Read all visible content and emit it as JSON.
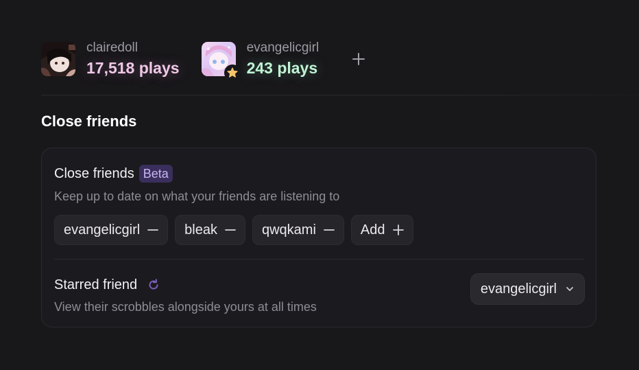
{
  "friends_row": {
    "users": [
      {
        "name": "clairedoll",
        "plays": "17,518 plays",
        "accent": "#f0c8e7"
      },
      {
        "name": "evangelicgirl",
        "plays": "243 plays",
        "accent": "#bff3d4"
      }
    ],
    "add_icon": "plus-icon"
  },
  "section": {
    "title": "Close friends"
  },
  "close_friends": {
    "title": "Close friends",
    "badge": "Beta",
    "description": "Keep up to date on what your friends are listening to",
    "chips": [
      {
        "label": "evangelicgirl",
        "icon": "minus-icon"
      },
      {
        "label": "bleak",
        "icon": "minus-icon"
      },
      {
        "label": "qwqkami",
        "icon": "minus-icon"
      }
    ],
    "add_label": "Add",
    "add_icon": "plus-icon"
  },
  "starred": {
    "title": "Starred friend",
    "icon": "refresh-icon",
    "description": "View their scrobbles alongside yours at all times",
    "selected": "evangelicgirl"
  },
  "colors": {
    "background": "#18171a",
    "badge_bg": "#3a2e5c",
    "badge_text": "#c8b6f2",
    "refresh_icon": "#7b5fb8"
  }
}
